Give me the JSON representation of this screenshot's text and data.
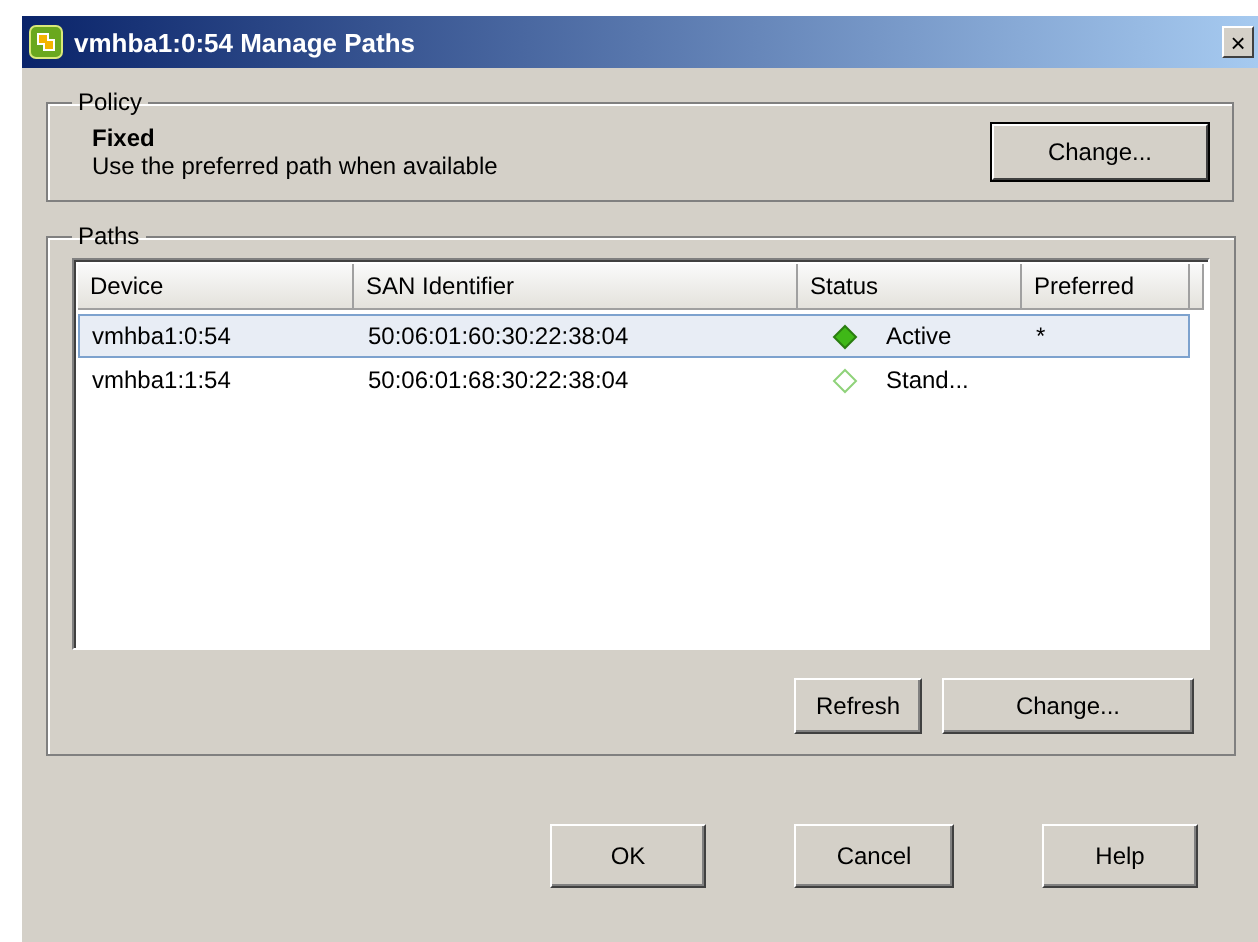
{
  "window": {
    "title": "vmhba1:0:54 Manage Paths",
    "close": "×"
  },
  "policy": {
    "legend": "Policy",
    "name": "Fixed",
    "description": "Use the preferred path when available",
    "button": "Change..."
  },
  "paths": {
    "legend": "Paths",
    "columns": [
      "Device",
      "SAN Identifier",
      "Status",
      "Preferred"
    ],
    "rows": [
      {
        "device": "vmhba1:0:54",
        "san": "50:06:01:60:30:22:38:04",
        "status": "Active",
        "active": true,
        "preferred": "*",
        "selected": true
      },
      {
        "device": "vmhba1:1:54",
        "san": "50:06:01:68:30:22:38:04",
        "status": "Stand...",
        "active": false,
        "selected": false
      }
    ],
    "buttons": [
      "Refresh",
      "Change..."
    ]
  },
  "buttons": [
    "OK",
    "Cancel",
    "Help"
  ]
}
